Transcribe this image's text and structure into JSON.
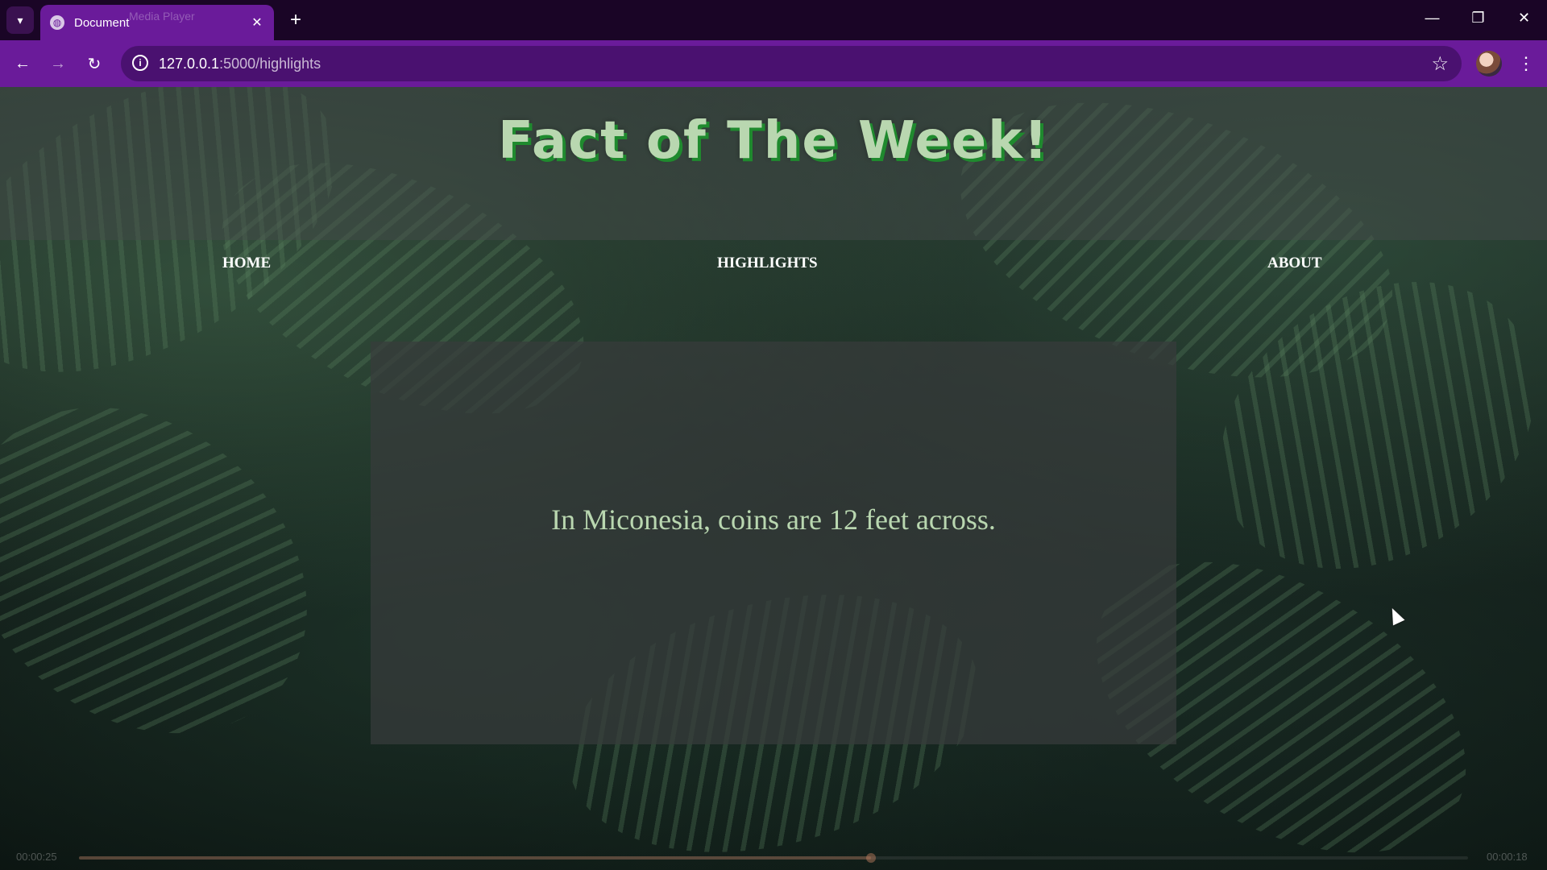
{
  "browser": {
    "tab": {
      "title": "Document",
      "ghost_title": "Media Player",
      "favicon": "globe-icon"
    },
    "url": {
      "host": "127.0.0.1",
      "path": ":5000/highlights"
    },
    "icons": {
      "tab_dropdown": "▾",
      "tab_close": "✕",
      "new_tab": "+",
      "back": "←",
      "forward": "→",
      "reload": "↻",
      "info": "i",
      "star": "☆",
      "menu": "⋮",
      "minimize": "—",
      "restore": "❐",
      "close": "✕"
    },
    "colors": {
      "tabbar": "#1a0526",
      "toolbar": "#6a1b9a",
      "omnibox": "#4a1170"
    }
  },
  "page": {
    "title": "Fact of The Week!",
    "nav": {
      "home": "HOME",
      "highlights": "HIGHLIGHTS",
      "about": "ABOUT"
    },
    "fact": "In Miconesia, coins are 12 feet across.",
    "colors": {
      "title": "#b9d7b0",
      "title_shadow": "#1f8a2e",
      "fact": "#b9d7b0"
    }
  },
  "media": {
    "elapsed": "00:00:25",
    "remaining": "00:00:18",
    "progress": 0.57
  }
}
